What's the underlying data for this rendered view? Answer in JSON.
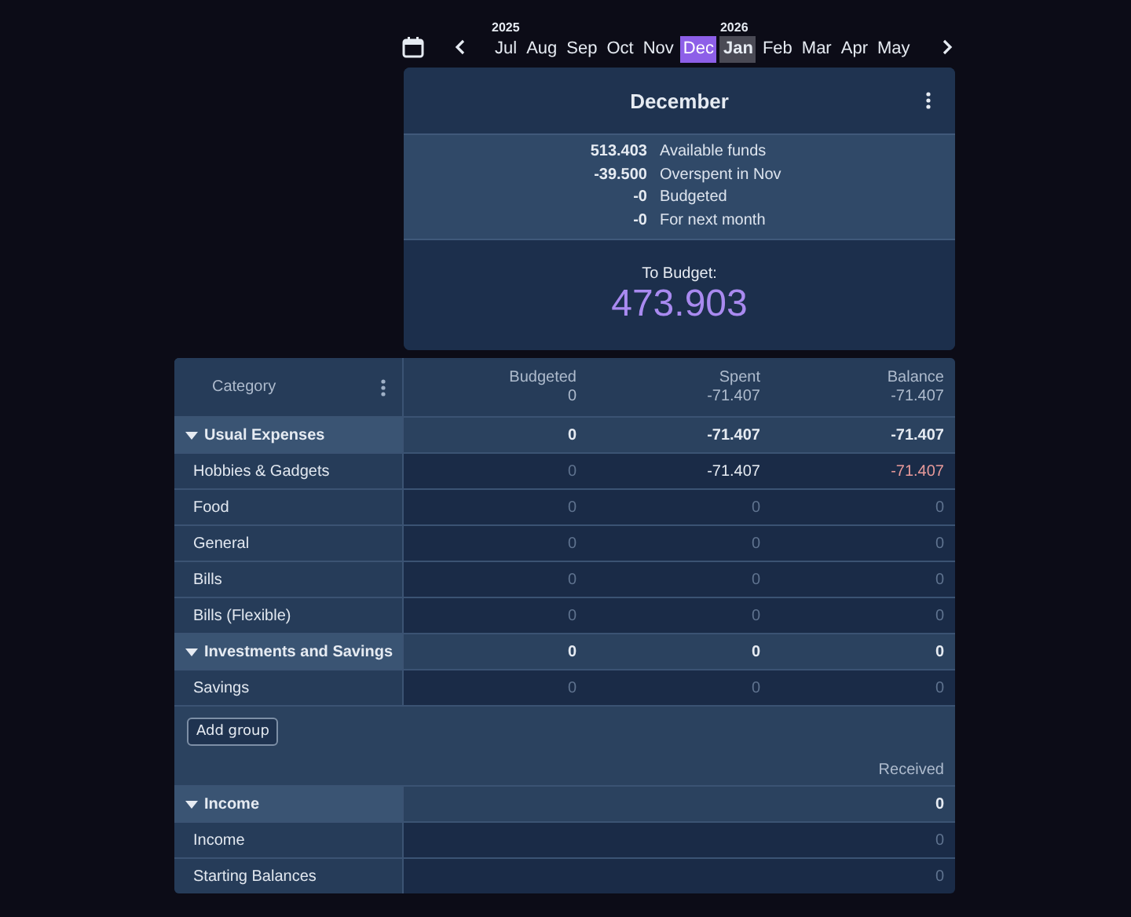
{
  "month_bar": {
    "months": [
      {
        "label": "Jul",
        "year": "2025",
        "selected": false,
        "current": false
      },
      {
        "label": "Aug",
        "selected": false,
        "current": false
      },
      {
        "label": "Sep",
        "selected": false,
        "current": false
      },
      {
        "label": "Oct",
        "selected": false,
        "current": false
      },
      {
        "label": "Nov",
        "selected": false,
        "current": false
      },
      {
        "label": "Dec",
        "selected": true,
        "current": false
      },
      {
        "label": "Jan",
        "year": "2026",
        "selected": false,
        "current": true
      },
      {
        "label": "Feb",
        "selected": false,
        "current": false
      },
      {
        "label": "Mar",
        "selected": false,
        "current": false
      },
      {
        "label": "Apr",
        "selected": false,
        "current": false
      },
      {
        "label": "May",
        "selected": false,
        "current": false
      }
    ]
  },
  "summary": {
    "title": "December",
    "lines": [
      {
        "amount": "513.403",
        "label": "Available funds"
      },
      {
        "amount": "-39.500",
        "label": "Overspent in Nov"
      },
      {
        "amount": "-0",
        "label": "Budgeted"
      },
      {
        "amount": "-0",
        "label": "For next month"
      }
    ],
    "to_budget_label": "To Budget:",
    "to_budget": "473.903"
  },
  "table": {
    "category_header": "Category",
    "columns": [
      {
        "label": "Budgeted",
        "total": "0"
      },
      {
        "label": "Spent",
        "total": "-71.407"
      },
      {
        "label": "Balance",
        "total": "-71.407"
      }
    ],
    "groups": [
      {
        "name": "Usual Expenses",
        "expanded": true,
        "values": [
          "0",
          "-71.407",
          "-71.407"
        ],
        "categories": [
          {
            "name": "Hobbies & Gadgets",
            "overspent": true,
            "values": [
              {
                "value": "0",
                "muted": true
              },
              {
                "value": "-71.407",
                "muted": false
              },
              {
                "value": "-71.407",
                "muted": false
              }
            ]
          },
          {
            "name": "Food",
            "overspent": false,
            "values": [
              {
                "value": "0",
                "muted": true
              },
              {
                "value": "0",
                "muted": true
              },
              {
                "value": "0",
                "muted": true
              }
            ]
          },
          {
            "name": "General",
            "overspent": false,
            "values": [
              {
                "value": "0",
                "muted": true
              },
              {
                "value": "0",
                "muted": true
              },
              {
                "value": "0",
                "muted": true
              }
            ]
          },
          {
            "name": "Bills",
            "overspent": false,
            "values": [
              {
                "value": "0",
                "muted": true
              },
              {
                "value": "0",
                "muted": true
              },
              {
                "value": "0",
                "muted": true
              }
            ]
          },
          {
            "name": "Bills (Flexible)",
            "overspent": false,
            "values": [
              {
                "value": "0",
                "muted": true
              },
              {
                "value": "0",
                "muted": true
              },
              {
                "value": "0",
                "muted": true
              }
            ]
          }
        ]
      },
      {
        "name": "Investments and Savings",
        "expanded": true,
        "values": [
          "0",
          "0",
          "0"
        ],
        "categories": [
          {
            "name": "Savings",
            "overspent": false,
            "values": [
              {
                "value": "0",
                "muted": true
              },
              {
                "value": "0",
                "muted": true
              },
              {
                "value": "0",
                "muted": true
              }
            ]
          }
        ]
      }
    ],
    "add_group": "Add group",
    "income": {
      "column": "Received",
      "groups": [
        {
          "name": "Income",
          "expanded": true,
          "received": "0",
          "categories": [
            {
              "name": "Income",
              "received": {
                "value": "0",
                "muted": true
              }
            },
            {
              "name": "Starting Balances",
              "received": {
                "value": "0",
                "muted": true
              }
            }
          ]
        }
      ]
    }
  }
}
